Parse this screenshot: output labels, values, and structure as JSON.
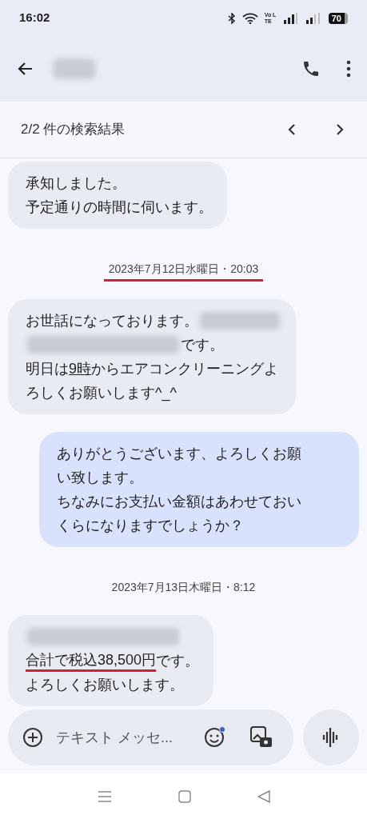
{
  "status_bar": {
    "time": "16:02",
    "network_label": "Vo LTE",
    "battery": "70"
  },
  "header": {
    "contact_blurred": true
  },
  "search_results": {
    "label": "2/2 件の検索結果"
  },
  "messages": [
    {
      "kind": "incoming",
      "lines": [
        [
          {
            "kind": "text",
            "text": "承知しました。"
          }
        ],
        [
          {
            "kind": "text",
            "text": "予定通りの時間に伺います。"
          }
        ]
      ]
    },
    {
      "kind": "date",
      "text": "2023年7月12日水曜日・20:03",
      "marked": true
    },
    {
      "kind": "incoming",
      "lines": [
        [
          {
            "kind": "text",
            "text": "お世話になっております。"
          },
          {
            "kind": "blurred"
          }
        ],
        [
          {
            "kind": "blurred"
          },
          {
            "kind": "text",
            "text": "です。"
          }
        ],
        [
          {
            "kind": "text",
            "text": "明日は"
          },
          {
            "kind": "link",
            "text": "9時"
          },
          {
            "kind": "text",
            "text": "からエアコンクリーニングよ"
          }
        ],
        [
          {
            "kind": "text",
            "text": "ろしくお願いします^_^"
          }
        ]
      ]
    },
    {
      "kind": "outgoing",
      "lines": [
        [
          {
            "kind": "text",
            "text": "ありがとうございます、よろしくお願"
          }
        ],
        [
          {
            "kind": "text",
            "text": "い致します。"
          }
        ],
        [
          {
            "kind": "text",
            "text": "ちなみにお支払い金額はあわせておい"
          }
        ],
        [
          {
            "kind": "text",
            "text": "くらになりますでしょうか？"
          }
        ]
      ]
    },
    {
      "kind": "date",
      "text": "2023年7月13日木曜日・8:12",
      "marked": false
    },
    {
      "kind": "incoming",
      "lines": [
        [
          {
            "kind": "blurred"
          }
        ],
        [
          {
            "kind": "text",
            "text": "合計で税込38,500円",
            "marked": true
          },
          {
            "kind": "text",
            "text": "です。"
          }
        ],
        [
          {
            "kind": "text",
            "text": "よろしくお願いします。"
          }
        ]
      ]
    }
  ],
  "composer": {
    "placeholder": "テキスト メッセ...",
    "emoji_badge": true
  }
}
